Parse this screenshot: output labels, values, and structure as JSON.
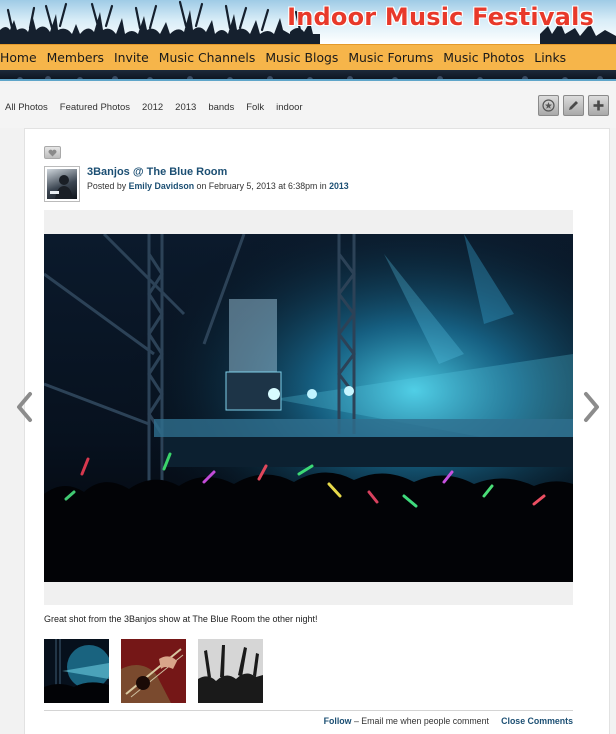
{
  "banner": {
    "title": "Indoor Music Festivals"
  },
  "nav": {
    "items": [
      {
        "label": "Home"
      },
      {
        "label": "Members"
      },
      {
        "label": "Invite"
      },
      {
        "label": "Music Channels"
      },
      {
        "label": "Music Blogs"
      },
      {
        "label": "Music Forums"
      },
      {
        "label": "Music Photos"
      },
      {
        "label": "Links"
      }
    ]
  },
  "subnav": {
    "links": [
      {
        "label": "All Photos"
      },
      {
        "label": "Featured Photos"
      },
      {
        "label": "2012"
      },
      {
        "label": "2013"
      },
      {
        "label": "bands"
      },
      {
        "label": "Folk"
      },
      {
        "label": "indoor"
      }
    ],
    "tools": [
      "star-icon",
      "pencil-icon",
      "plus-icon"
    ]
  },
  "post": {
    "title": "3Banjos @ The Blue Room",
    "posted_by_prefix": "Posted by",
    "author": "Emily Davidson",
    "date_text": "on February 5, 2013 at 6:38pm in",
    "album": "2013",
    "caption": "Great shot from the 3Banjos show at The Blue Room the other night!"
  },
  "footer": {
    "follow_label": "Follow",
    "follow_desc": "– Email me when people comment",
    "close_label": "Close Comments"
  },
  "colors": {
    "nav_bg": "#f6b54a",
    "title_red": "#e8392a",
    "link_blue": "#1c4f73"
  }
}
